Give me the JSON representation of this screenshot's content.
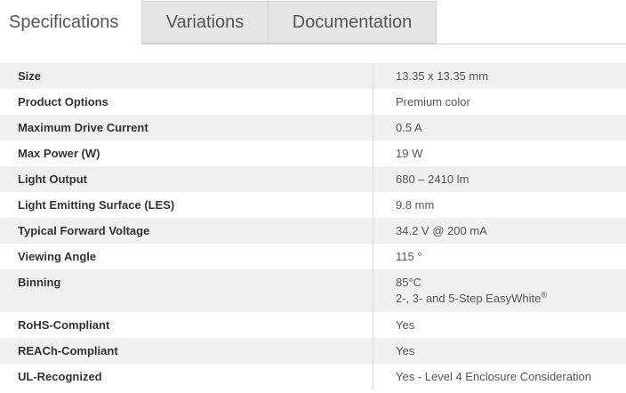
{
  "tabs": [
    {
      "label": "Specifications",
      "active": true
    },
    {
      "label": "Variations",
      "active": false
    },
    {
      "label": "Documentation",
      "active": false
    }
  ],
  "specs": [
    {
      "label": "Size",
      "value": "13.35 x 13.35 mm"
    },
    {
      "label": "Product Options",
      "value": "Premium color"
    },
    {
      "label": "Maximum Drive Current",
      "value": "0.5 A"
    },
    {
      "label": "Max Power (W)",
      "value": "19 W"
    },
    {
      "label": "Light Output",
      "value": "680 – 2410 lm"
    },
    {
      "label": "Light Emitting Surface (LES)",
      "value": "9.8 mm"
    },
    {
      "label": "Typical Forward Voltage",
      "value": "34.2 V @ 200 mA"
    },
    {
      "label": "Viewing Angle",
      "value": "115 °"
    },
    {
      "label": "Binning",
      "value": "85°C",
      "value_line2": "2-, 3- and 5-Step EasyWhite",
      "value_line2_sup": "®"
    },
    {
      "label": "RoHS-Compliant",
      "value": "Yes"
    },
    {
      "label": "REACh-Compliant",
      "value": "Yes"
    },
    {
      "label": "UL-Recognized",
      "value": "Yes - Level 4 Enclosure Consideration"
    }
  ]
}
